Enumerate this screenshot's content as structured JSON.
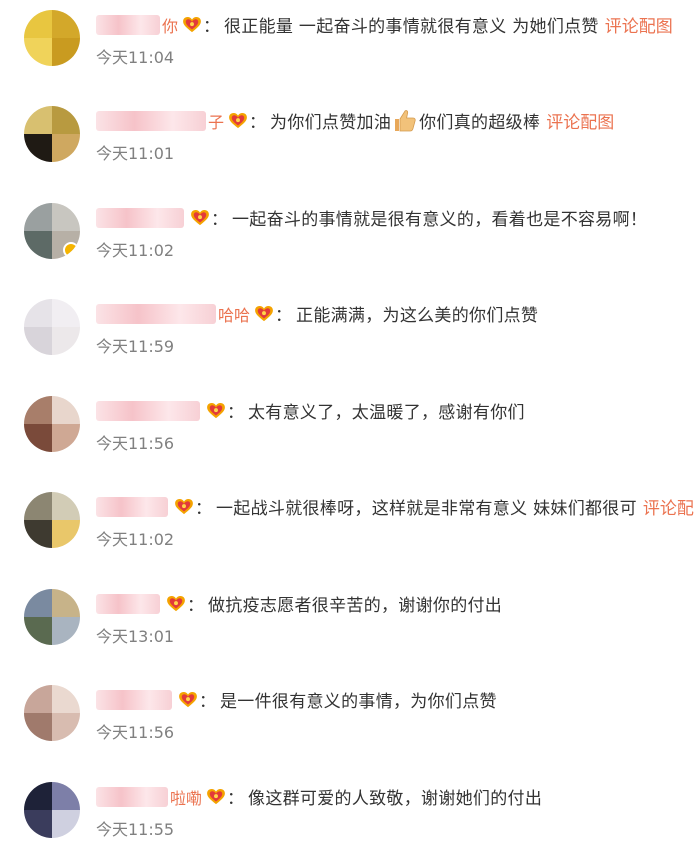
{
  "comments": [
    {
      "name_suffix": "你",
      "text": "很正能量 一起奋斗的事情就很有意义 为她们点赞",
      "has_thumb": false,
      "text_after": "",
      "link": "评论配图",
      "time": "今天11:04",
      "avatar_colors": [
        "#e8c640",
        "#d3a82a",
        "#f0d35a",
        "#c99b20"
      ],
      "badge": false
    },
    {
      "name_suffix": "子",
      "text": "为你们点赞加油",
      "has_thumb": true,
      "text_after": "你们真的超级棒",
      "link": "评论配图",
      "time": "今天11:01",
      "avatar_colors": [
        "#d8c070",
        "#b89a40",
        "#1f1a14",
        "#cfa860"
      ],
      "badge": false
    },
    {
      "name_suffix": "",
      "text": "一起奋斗的事情就是很有意义的，看着也是不容易啊！",
      "has_thumb": false,
      "text_after": "",
      "link": "",
      "time": "今天11:02",
      "avatar_colors": [
        "#9aa0a0",
        "#c8c6c0",
        "#5d6a66",
        "#b7b0a6"
      ],
      "badge": true
    },
    {
      "name_suffix": "哈哈",
      "text": "正能满满，为这么美的你们点赞",
      "has_thumb": false,
      "text_after": "",
      "link": "",
      "time": "今天11:59",
      "avatar_colors": [
        "#e6e3e8",
        "#f1eef2",
        "#d8d4da",
        "#ece8ea"
      ],
      "badge": false
    },
    {
      "name_suffix": "",
      "text": "太有意义了，太温暖了，感谢有你们",
      "has_thumb": false,
      "text_after": "",
      "link": "",
      "time": "今天11:56",
      "avatar_colors": [
        "#a87e6a",
        "#e8d6cc",
        "#7a4a3a",
        "#cfa894"
      ],
      "badge": false
    },
    {
      "name_suffix": "",
      "text": "一起战斗就很棒呀，这样就是非常有意义 妹妹们都很可",
      "has_thumb": false,
      "text_after": "",
      "link": "评论配图",
      "time": "今天11:02",
      "avatar_colors": [
        "#8c8672",
        "#d2ccb6",
        "#3e3a30",
        "#e9c76a"
      ],
      "badge": false
    },
    {
      "name_suffix": "",
      "text": "做抗疫志愿者很辛苦的，谢谢你的付出",
      "has_thumb": false,
      "text_after": "",
      "link": "",
      "time": "今天13:01",
      "avatar_colors": [
        "#7a8aa0",
        "#c7b389",
        "#5a6a50",
        "#a9b4c0"
      ],
      "badge": false
    },
    {
      "name_suffix": "",
      "text": "是一件很有意义的事情，为你们点赞",
      "has_thumb": false,
      "text_after": "",
      "link": "",
      "time": "今天11:56",
      "avatar_colors": [
        "#c8a69a",
        "#ead9d0",
        "#a07a6c",
        "#d8bcb0"
      ],
      "badge": false
    },
    {
      "name_suffix": "啦嘞",
      "text": "像这群可爱的人致敬，谢谢她们的付出",
      "has_thumb": false,
      "text_after": "",
      "link": "",
      "time": "今天11:55",
      "avatar_colors": [
        "#1e2238",
        "#7d7fa8",
        "#3a3c5c",
        "#cfd0e0"
      ],
      "badge": false
    }
  ]
}
